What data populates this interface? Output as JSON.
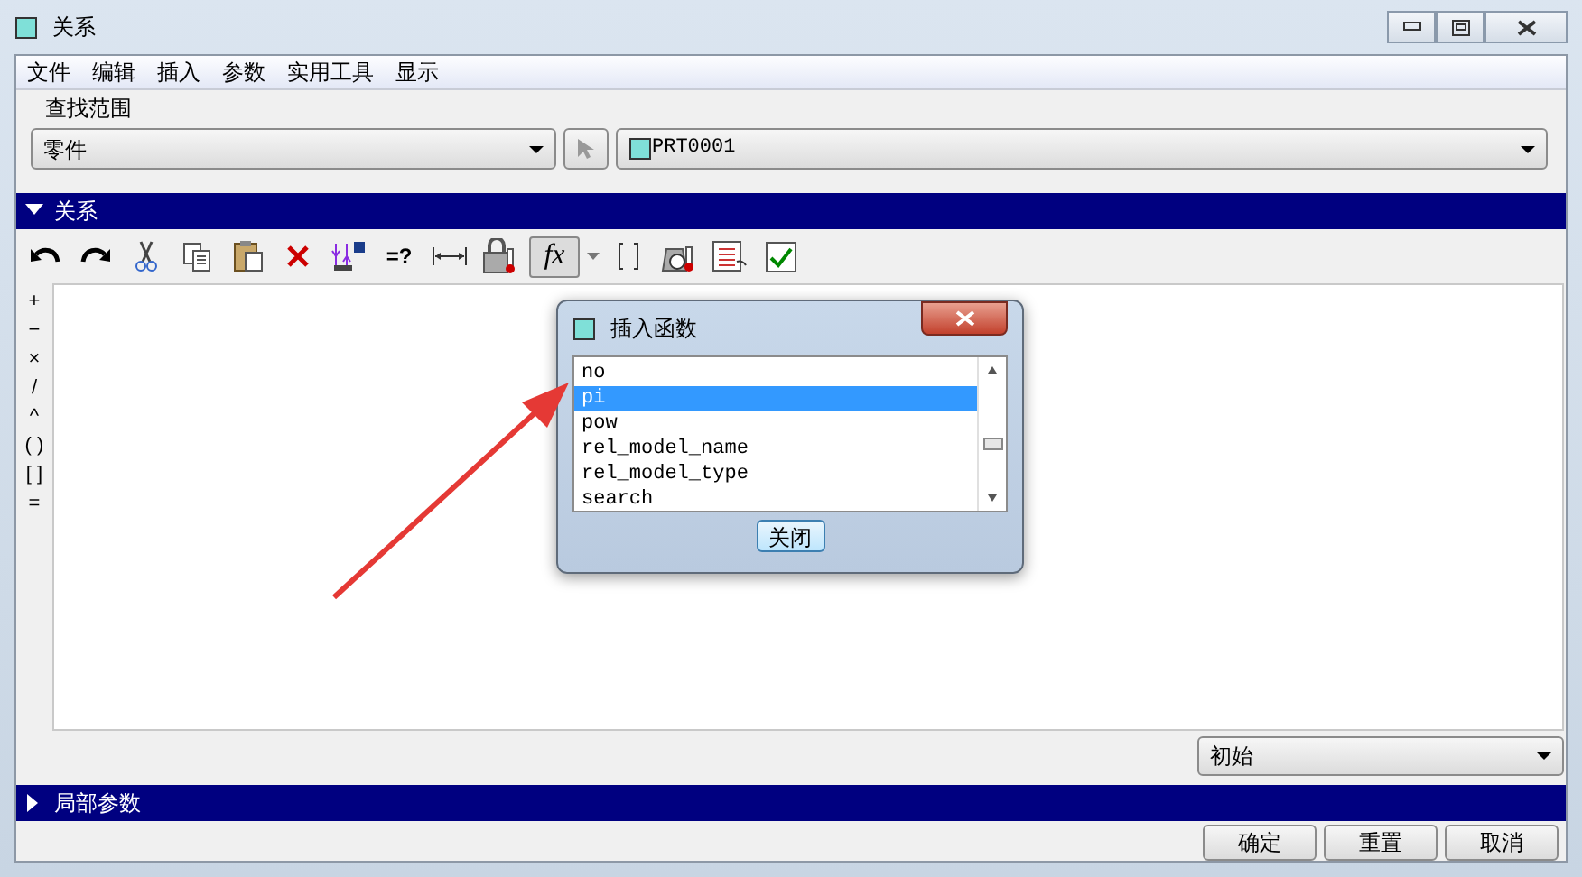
{
  "window": {
    "title": "关系"
  },
  "menu": [
    "文件",
    "编辑",
    "插入",
    "参数",
    "实用工具",
    "显示"
  ],
  "lookup": {
    "label": "查找范围",
    "scope": "零件",
    "model": "PRT0001"
  },
  "relations_section": {
    "title": "关系",
    "expanded": true
  },
  "toolbar": {
    "query_label": "=?",
    "function_label": "fx",
    "function_pressed": true
  },
  "operators": [
    "+",
    "−",
    "×",
    "/",
    "^",
    "( )",
    "[ ]",
    "="
  ],
  "sort_combo": "初始",
  "local_params_section": {
    "title": "局部参数",
    "expanded": false
  },
  "buttons": [
    "确定",
    "重置",
    "取消"
  ],
  "dialog": {
    "title": "插入函数",
    "close_label": "关闭",
    "functions": [
      {
        "name": "no",
        "selected": false
      },
      {
        "name": "pi",
        "selected": true
      },
      {
        "name": "pow",
        "selected": false
      },
      {
        "name": "rel_model_name",
        "selected": false
      },
      {
        "name": "rel_model_type",
        "selected": false
      },
      {
        "name": "search",
        "selected": false
      }
    ]
  }
}
